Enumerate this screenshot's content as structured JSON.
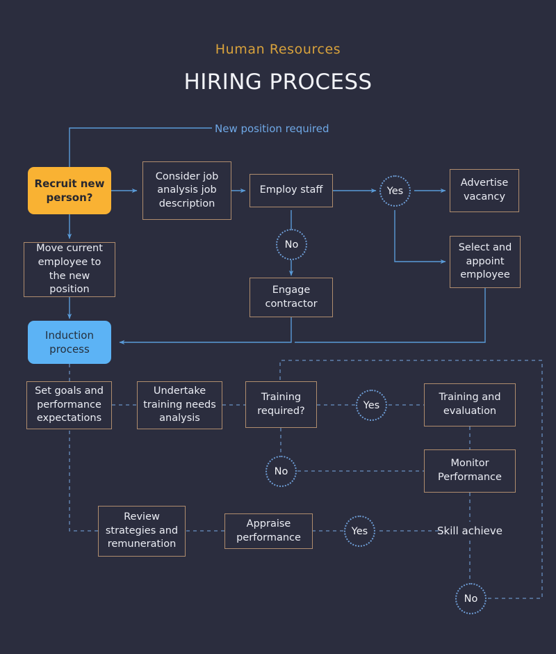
{
  "header": {
    "subtitle": "Human Resources",
    "title": "HIRING PROCESS"
  },
  "colors": {
    "background": "#2b2d3e",
    "accent_amber": "#f9b233",
    "accent_blue": "#5cb3f5",
    "box_border": "#b08d6e",
    "wire_solid": "#5a9bd8",
    "wire_dashed": "#5f82ad",
    "subtitle": "#d8a23c",
    "text": "#eceef5"
  },
  "edge_labels": [
    {
      "id": "new-position-required",
      "text": "New position required"
    }
  ],
  "nodes": [
    {
      "id": "recruit-new-person",
      "text": "Recruit new person?",
      "shape": "rounded",
      "style": "amber"
    },
    {
      "id": "consider-job-analysis",
      "text": "Consider job analysis job description",
      "shape": "rect",
      "style": "box"
    },
    {
      "id": "employ-staff",
      "text": "Employ staff",
      "shape": "rect",
      "style": "box"
    },
    {
      "id": "advertise-vacancy",
      "text": "Advertise vacancy",
      "shape": "rect",
      "style": "box"
    },
    {
      "id": "select-appoint-employee",
      "text": "Select and appoint employee",
      "shape": "rect",
      "style": "box"
    },
    {
      "id": "move-current-employee",
      "text": "Move current employee to the new position",
      "shape": "rect",
      "style": "box"
    },
    {
      "id": "engage-contractor",
      "text": "Engage contractor",
      "shape": "rect",
      "style": "box"
    },
    {
      "id": "induction-process",
      "text": "Induction process",
      "shape": "rounded",
      "style": "lblue"
    },
    {
      "id": "set-goals",
      "text": "Set goals and performance expectations",
      "shape": "rect",
      "style": "box"
    },
    {
      "id": "undertake-training",
      "text": "Undertake training needs analysis",
      "shape": "rect",
      "style": "box"
    },
    {
      "id": "training-required",
      "text": "Training required?",
      "shape": "rect",
      "style": "box"
    },
    {
      "id": "training-and-evaluation",
      "text": "Training and evaluation",
      "shape": "rect",
      "style": "box"
    },
    {
      "id": "monitor-performance",
      "text": "Monitor Performance",
      "shape": "rect",
      "style": "box"
    },
    {
      "id": "review-strategies",
      "text": "Review strategies and remuneration",
      "shape": "rect",
      "style": "box"
    },
    {
      "id": "appraise-performance",
      "text": "Appraise performance",
      "shape": "rect",
      "style": "box"
    },
    {
      "id": "skill-achieve",
      "text": "Skill achieve",
      "shape": "none",
      "style": "plain"
    }
  ],
  "decisions": [
    {
      "id": "yes-employ-staff",
      "text": "Yes"
    },
    {
      "id": "no-employ-staff",
      "text": "No"
    },
    {
      "id": "yes-training-required",
      "text": "Yes"
    },
    {
      "id": "no-training-required",
      "text": "No"
    },
    {
      "id": "yes-appraise",
      "text": "Yes"
    },
    {
      "id": "no-skill-achieve",
      "text": "No"
    }
  ]
}
